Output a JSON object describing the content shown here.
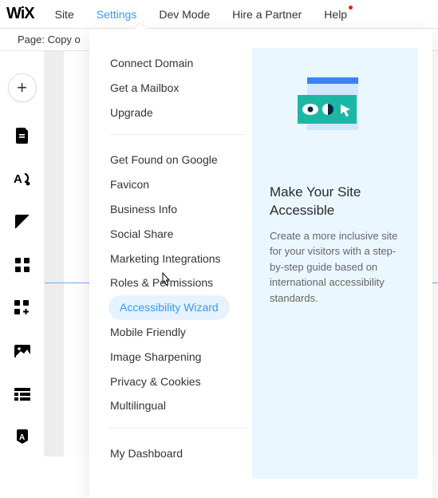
{
  "logo": "WiX",
  "topnav": {
    "site": "Site",
    "settings": "Settings",
    "dev": "Dev Mode",
    "partner": "Hire a Partner",
    "help": "Help"
  },
  "secondbar": {
    "page_label": "Page: Copy o"
  },
  "settings_menu": {
    "group1": [
      "Connect Domain",
      "Get a Mailbox",
      "Upgrade"
    ],
    "group2": [
      "Get Found on Google",
      "Favicon",
      "Business Info",
      "Social Share",
      "Marketing Integrations",
      "Roles & Permissions",
      "Accessibility Wizard",
      "Mobile Friendly",
      "Image Sharpening",
      "Privacy & Cookies",
      "Multilingual"
    ],
    "group3": [
      "My Dashboard"
    ],
    "hovered_index": 6
  },
  "info_panel": {
    "title": "Make Your Site Accessible",
    "body": "Create a more inclusive site for your visitors with a step-by-step guide based on international accessibility standards."
  },
  "colors": {
    "accent": "#3899ec",
    "info_bg": "#eaf7ff",
    "illus_teal": "#1cb7a4",
    "illus_blue": "#3b82f6"
  }
}
